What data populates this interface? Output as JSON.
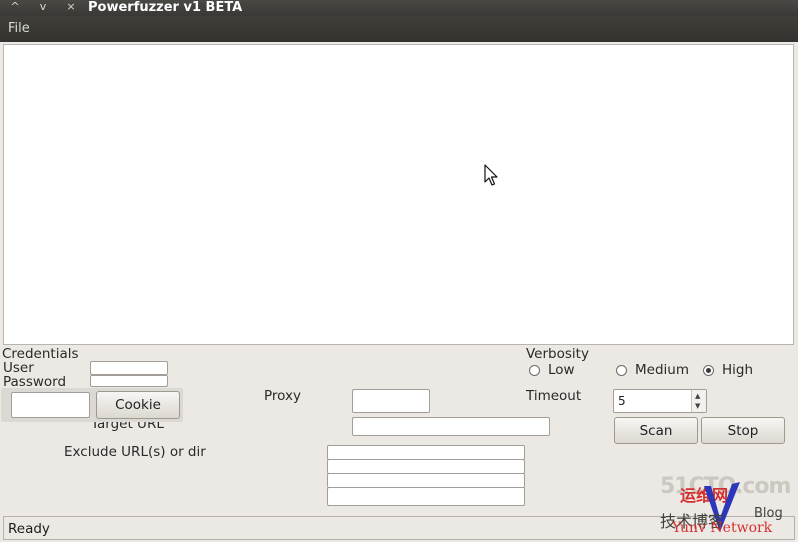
{
  "window": {
    "title": "Powerfuzzer v1 BETA",
    "controls": [
      "^",
      "v",
      "×"
    ]
  },
  "menu": {
    "file": "File"
  },
  "credentials": {
    "section_label": "Credentials",
    "user_label": "User",
    "password_label": "Password",
    "user_value": "",
    "password_value": ""
  },
  "cookie": {
    "value": "",
    "button_label": "Cookie"
  },
  "target": {
    "label": "Target URL",
    "value": ""
  },
  "proxy": {
    "label": "Proxy",
    "value": ""
  },
  "exclude": {
    "label": "Exclude URL(s) or dir",
    "values": [
      "",
      "",
      "",
      ""
    ]
  },
  "verbosity": {
    "label": "Verbosity",
    "options": [
      {
        "label": "Low",
        "selected": false
      },
      {
        "label": "Medium",
        "selected": false
      },
      {
        "label": "High",
        "selected": true
      }
    ]
  },
  "timeout": {
    "label": "Timeout",
    "value": "5"
  },
  "actions": {
    "scan_label": "Scan",
    "stop_label": "Stop"
  },
  "status": {
    "text": "Ready"
  },
  "watermark": {
    "site": "51CTO.com",
    "cn_top": "运维网",
    "cn_bottom": "技术博客",
    "blog": "Blog",
    "network": "Yunv Network"
  },
  "colors": {
    "titlebar": "#3f3e3a",
    "window_bg": "#ece9e4",
    "output_bg": "#ffffff",
    "watermark_blue": "#1b2ab8",
    "watermark_red": "#d32020"
  }
}
